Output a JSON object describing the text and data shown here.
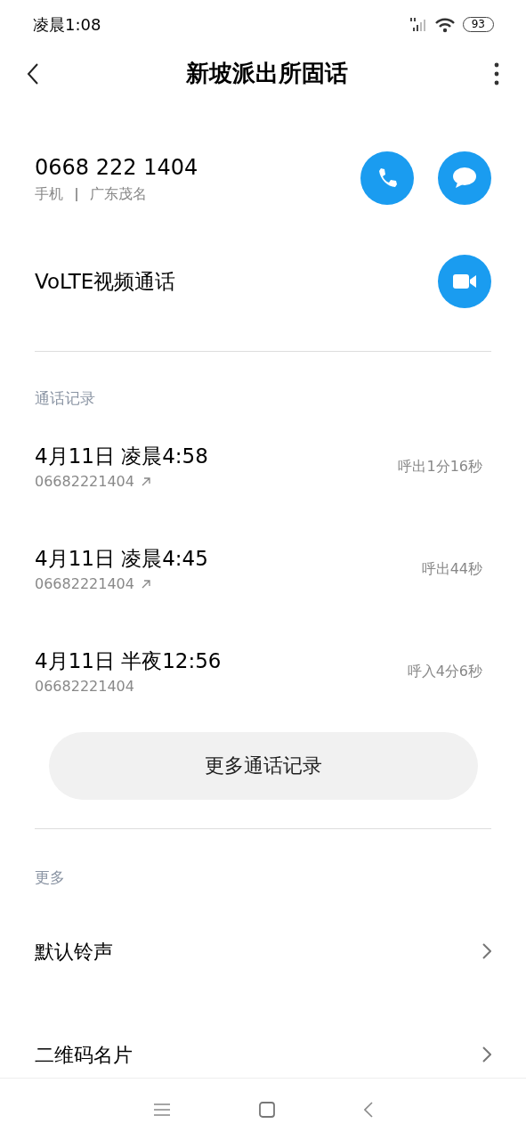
{
  "status_bar": {
    "time": "凌晨1:08",
    "battery": "93"
  },
  "header": {
    "title": "新坡派出所固话"
  },
  "contact": {
    "number": "0668 222 1404",
    "type": "手机",
    "location": "广东茂名"
  },
  "video_call": {
    "label": "VoLTE视频通话"
  },
  "call_log": {
    "heading": "通话记录",
    "entries": [
      {
        "date": "4月11日 凌晨4:58",
        "number": "06682221404",
        "kind": "outgoing",
        "duration": "呼出1分16秒"
      },
      {
        "date": "4月11日 凌晨4:45",
        "number": "06682221404",
        "kind": "outgoing",
        "duration": "呼出44秒"
      },
      {
        "date": "4月11日 半夜12:56",
        "number": "06682221404",
        "kind": "incoming",
        "duration": "呼入4分6秒"
      }
    ],
    "more_button": "更多通话记录"
  },
  "more": {
    "heading": "更多",
    "items": [
      {
        "label": "默认铃声"
      },
      {
        "label": "二维码名片"
      }
    ]
  }
}
